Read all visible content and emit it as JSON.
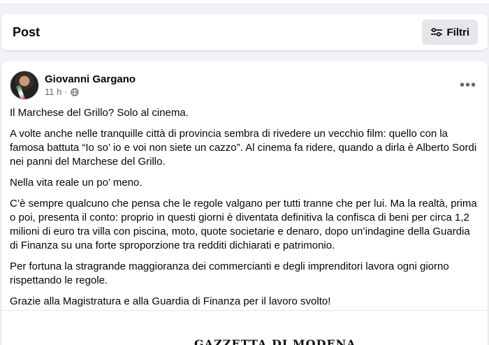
{
  "header": {
    "title": "Post",
    "filter_label": "Filtri",
    "filter_icon": "sliders-icon"
  },
  "post": {
    "author": "Giovanni Gargano",
    "time": "11 h",
    "separator": "·",
    "privacy_icon": "globe-icon",
    "more_label": "•••",
    "paragraphs": [
      "Il Marchese del Grillo? Solo al cinema.",
      "A volte anche nelle tranquille città di provincia sembra di rivedere un vecchio film: quello con la famosa battuta “Io so’ io e voi non siete un cazzo”. Al cinema fa ridere, quando a dirla è Alberto Sordi nei panni del Marchese del Grillo.",
      "Nella vita reale un po’ meno.",
      "C’è sempre qualcuno che pensa che le regole valgano per tutti tranne che per lui. Ma la realtà, prima o poi, presenta il conto: proprio in questi giorni è diventata definitiva la confisca di beni per circa 1,2 milioni di euro tra villa con piscina, moto, quote societarie e denaro, dopo un’indagine della Guardia di Finanza su una forte sproporzione tra redditi dichiarati e patrimonio.",
      "Per fortuna la stragrande maggioranza dei commercianti e degli imprenditori lavora ogni giorno rispettando le regole.",
      "Grazie alla Magistratura e alla Guardia di Finanza per il lavoro svolto!"
    ],
    "attachment_logo": "GAZZETTA DI MODENA"
  },
  "colors": {
    "background": "#f0f2f5",
    "card": "#ffffff",
    "secondary_text": "#65676b",
    "button_bg": "#e4e6eb"
  }
}
